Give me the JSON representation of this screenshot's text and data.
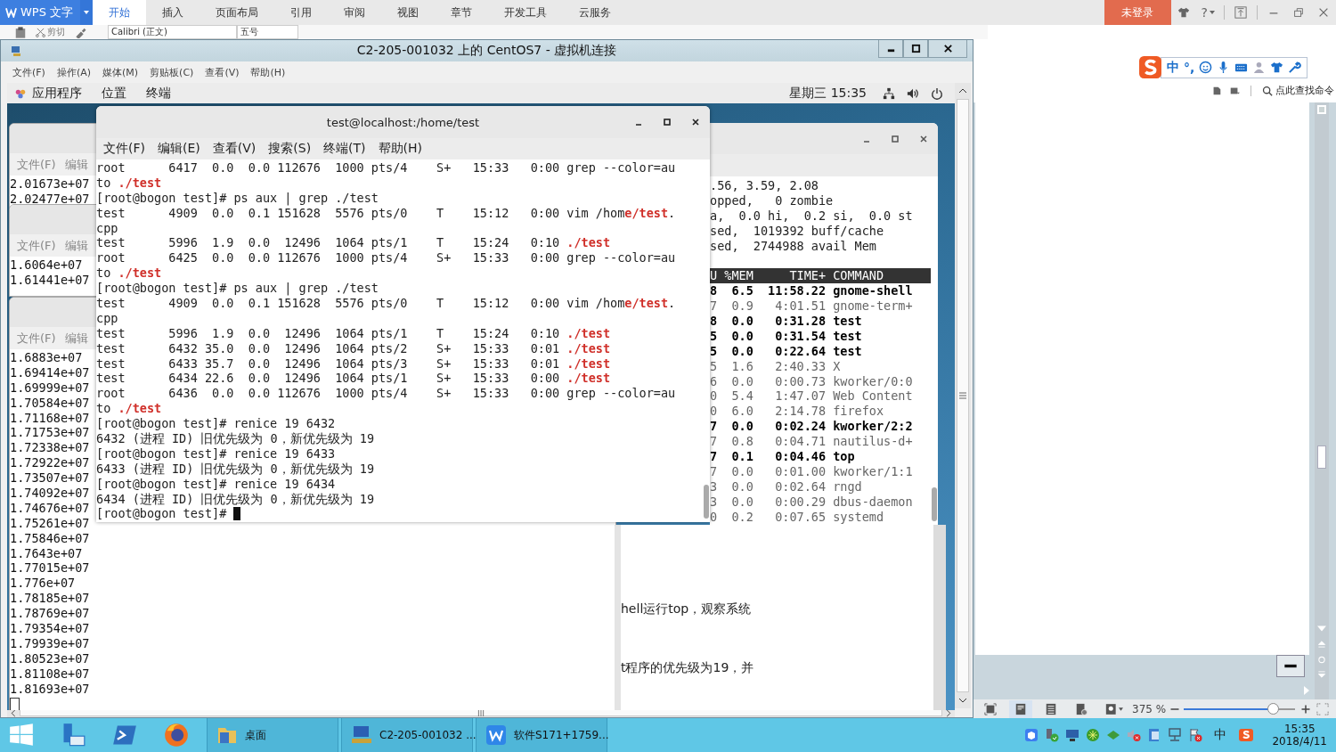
{
  "wps": {
    "app_name": "WPS 文字",
    "tabs": [
      {
        "label": "开始",
        "selected": true
      },
      {
        "label": "插入",
        "selected": false
      },
      {
        "label": "页面布局",
        "selected": false
      },
      {
        "label": "引用",
        "selected": false
      },
      {
        "label": "审阅",
        "selected": false
      },
      {
        "label": "视图",
        "selected": false
      },
      {
        "label": "章节",
        "selected": false
      },
      {
        "label": "开发工具",
        "selected": false
      },
      {
        "label": "云服务",
        "selected": false
      }
    ],
    "login": "未登录",
    "help": "?",
    "cut": "剪切",
    "font_name": "Calibri (正文)",
    "font_size": "五号",
    "ime": {
      "mode": "中",
      "punctuation": "°,"
    },
    "command_search": "点此查找命令",
    "zoom": "375 %",
    "zoom_slider": {
      "level": 0.81
    }
  },
  "vm": {
    "title": "C2-205-001032 上的 CentOS7 - 虚拟机连接",
    "menu": [
      "文件(F)",
      "操作(A)",
      "媒体(M)",
      "剪贴板(C)",
      "查看(V)",
      "帮助(H)"
    ],
    "gnome_menu": [
      "应用程序",
      "位置",
      "终端"
    ],
    "clock": "星期三 15:35",
    "back_windows": [
      {
        "menu": [
          "文件(F)",
          "编辑"
        ],
        "lines": [
          "2.01673e+07",
          "2.02477e+07"
        ]
      },
      {
        "menu": [
          "文件(F)",
          "编辑"
        ],
        "lines": [
          "1.6064e+07",
          "1.61441e+07"
        ]
      },
      {
        "menu": [
          "文件(F)",
          "编辑"
        ],
        "lines": [
          "1.6883e+07",
          "1.69414e+07",
          "1.69999e+07",
          "1.70584e+07",
          "1.71168e+07",
          "1.71753e+07",
          "1.72338e+07",
          "1.72922e+07",
          "1.73507e+07",
          "1.74092e+07",
          "1.74676e+07",
          "1.75261e+07",
          "1.75846e+07",
          "1.7643e+07",
          "1.77015e+07",
          "1.776e+07",
          "1.78185e+07",
          "1.78769e+07",
          "1.79354e+07",
          "1.79939e+07",
          "1.80523e+07",
          "1.81108e+07",
          "1.81693e+07"
        ]
      }
    ],
    "terminal": {
      "title": "test@localhost:/home/test",
      "menu": [
        "文件(F)",
        "编辑(E)",
        "查看(V)",
        "搜索(S)",
        "终端(T)",
        "帮助(H)"
      ],
      "lines": [
        "root      6417  0.0  0.0 112676  1000 pts/4    S+   15:33   0:00 grep --color=au",
        "to **./test**",
        "[root@bogon test]# ps aux | grep ./test",
        "test      4909  0.0  0.1 151628  5576 pts/0    T    15:12   0:00 vim /hom**e/test**.",
        "cpp",
        "test      5996  1.9  0.0  12496  1064 pts/1    T    15:24   0:10 **./test**",
        "root      6425  0.0  0.0 112676  1000 pts/4    S+   15:33   0:00 grep --color=au",
        "to **./test**",
        "[root@bogon test]# ps aux | grep ./test",
        "test      4909  0.0  0.1 151628  5576 pts/0    T    15:12   0:00 vim /hom**e/test**.",
        "cpp",
        "test      5996  1.9  0.0  12496  1064 pts/1    T    15:24   0:10 **./test**",
        "test      6432 35.0  0.0  12496  1064 pts/2    S+   15:33   0:01 **./test**",
        "test      6433 35.7  0.0  12496  1064 pts/3    S+   15:33   0:01 **./test**",
        "test      6434 22.6  0.0  12496  1064 pts/1    S+   15:33   0:00 **./test**",
        "root      6436  0.0  0.0 112676  1000 pts/4    S+   15:33   0:00 grep --color=au",
        "to **./test**",
        "[root@bogon test]# renice 19 6432",
        "6432 (进程 ID) 旧优先级为 0，新优先级为 19",
        "[root@bogon test]# renice 19 6433",
        "6433 (进程 ID) 旧优先级为 0，新优先级为 19",
        "[root@bogon test]# renice 19 6434",
        "6434 (进程 ID) 旧优先级为 0，新优先级为 19",
        "[root@bogon test]# "
      ],
      "cursor": true
    },
    "top": {
      "summary": [
        ".56, 3.59, 2.08",
        "opped,   0 zombie",
        "a,  0.0 hi,  0.2 si,  0.0 st",
        "sed,  1019392 buff/cache",
        "sed,  2744988 avail Mem"
      ],
      "header": "U %MEM     TIME+ COMMAND",
      "rows": [
        {
          "text": "8  6.5  11:58.22 gnome-shell",
          "running": true
        },
        {
          "text": "7  0.9   4:01.51 gnome-term+",
          "running": false
        },
        {
          "text": "8  0.0   0:31.28 test",
          "running": true
        },
        {
          "text": "5  0.0   0:31.54 test",
          "running": true
        },
        {
          "text": "5  0.0   0:22.64 test",
          "running": true
        },
        {
          "text": "5  1.6   2:40.33 X",
          "running": false
        },
        {
          "text": "6  0.0   0:00.73 kworker/0:0",
          "running": false
        },
        {
          "text": "0  5.4   1:47.07 Web Content",
          "running": false
        },
        {
          "text": "0  6.0   2:14.78 firefox",
          "running": false
        },
        {
          "text": "7  0.0   0:02.24 kworker/2:2",
          "running": true
        },
        {
          "text": "7  0.8   0:04.71 nautilus-d+",
          "running": false
        },
        {
          "text": "7  0.1   0:04.46 top",
          "running": true
        },
        {
          "text": "7  0.0   0:01.00 kworker/1:1",
          "running": false
        },
        {
          "text": "3  0.0   0:02.64 rngd",
          "running": false
        },
        {
          "text": "3  0.0   0:00.29 dbus-daemon",
          "running": false
        },
        {
          "text": "0  0.2   0:07.65 systemd",
          "running": false
        }
      ]
    },
    "document": {
      "lines": [
        "hell运行top，观察系统",
        "t程序的优先级为19，并"
      ]
    }
  },
  "taskbar": {
    "windows": [
      {
        "label": "桌面",
        "kind": "folder"
      },
      {
        "label": "C2-205-001032 ...",
        "kind": "vm"
      },
      {
        "label": "软件S171+1759...",
        "kind": "wps"
      }
    ],
    "ime": "中",
    "time": "15:35",
    "date": "2018/4/11"
  }
}
